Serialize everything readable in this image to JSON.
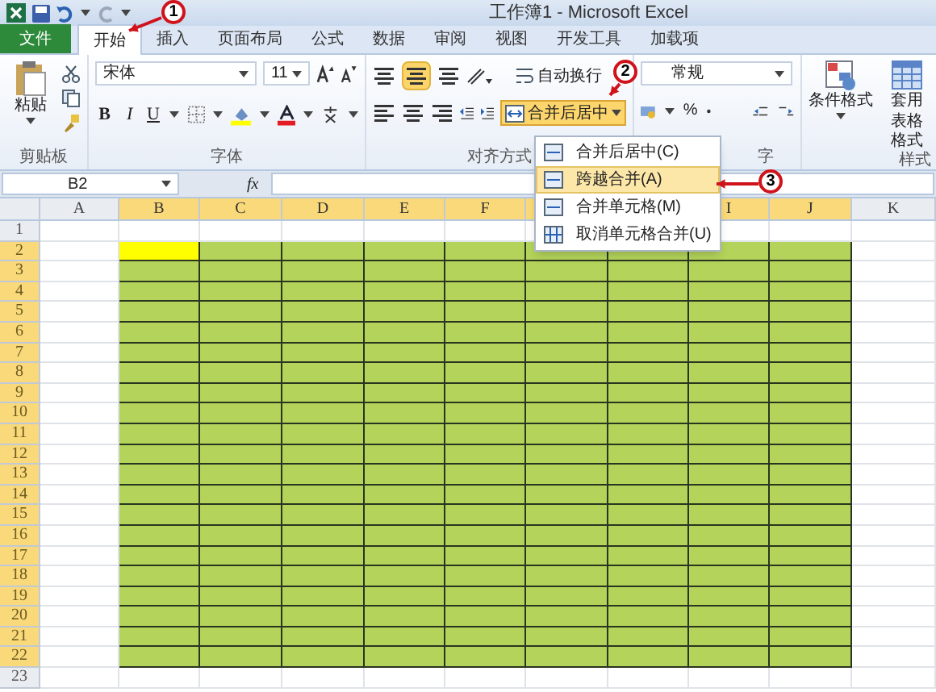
{
  "window": {
    "title": "工作簿1 - Microsoft Excel"
  },
  "tabs": [
    {
      "label": "文件",
      "kind": "file",
      "selected": false
    },
    {
      "label": "开始",
      "kind": "tab",
      "selected": true
    },
    {
      "label": "插入",
      "kind": "tab",
      "selected": false
    },
    {
      "label": "页面布局",
      "kind": "tab",
      "selected": false
    },
    {
      "label": "公式",
      "kind": "tab",
      "selected": false
    },
    {
      "label": "数据",
      "kind": "tab",
      "selected": false
    },
    {
      "label": "审阅",
      "kind": "tab",
      "selected": false
    },
    {
      "label": "视图",
      "kind": "tab",
      "selected": false
    },
    {
      "label": "开发工具",
      "kind": "tab",
      "selected": false
    },
    {
      "label": "加载项",
      "kind": "tab",
      "selected": false
    }
  ],
  "ribbon": {
    "clipboard": {
      "paste": "粘贴",
      "label": "剪贴板"
    },
    "font": {
      "name": "宋体",
      "size": "11",
      "bold": "B",
      "italic": "I",
      "underline": "U",
      "label": "字体"
    },
    "alignment": {
      "wrap": "自动换行",
      "merge": "合并后居中",
      "merge_open": true,
      "label": "对齐方式"
    },
    "number": {
      "format": "常规",
      "percent": "%",
      "label": "字"
    },
    "styles": {
      "conditional": "条件格式",
      "table": "套用表格格式",
      "label": "样式"
    }
  },
  "merge_menu": {
    "items": [
      {
        "label": "合并后居中(C)",
        "selected": false
      },
      {
        "label": "跨越合并(A)",
        "selected": true
      },
      {
        "label": "合并单元格(M)",
        "selected": false
      },
      {
        "label": "取消单元格合并(U)",
        "selected": false
      }
    ]
  },
  "formula_bar": {
    "name_box": "B2",
    "fx": "fx"
  },
  "sheet": {
    "columns": [
      {
        "label": "A",
        "selected": false
      },
      {
        "label": "B",
        "selected": true,
        "active": true
      },
      {
        "label": "C",
        "selected": true
      },
      {
        "label": "D",
        "selected": true
      },
      {
        "label": "E",
        "selected": true
      },
      {
        "label": "F",
        "selected": true
      },
      {
        "selected": true
      },
      {
        "selected": true
      },
      {
        "label": "I",
        "selected": true
      },
      {
        "label": "J",
        "selected": true
      },
      {
        "label": "K",
        "selected": false
      }
    ],
    "rows": [
      {
        "label": "1",
        "selected": false
      },
      {
        "label": "2",
        "selected": true,
        "active": true
      },
      {
        "label": "3",
        "selected": true,
        "active": false
      },
      {
        "label": "4",
        "selected": true,
        "active": false
      },
      {
        "label": "5",
        "selected": true,
        "active": false
      },
      {
        "label": "6",
        "selected": true,
        "active": false
      },
      {
        "label": "7",
        "selected": true,
        "active": false
      },
      {
        "label": "8",
        "selected": true,
        "active": false
      },
      {
        "label": "9",
        "selected": true,
        "active": false
      },
      {
        "label": "10",
        "selected": true,
        "active": false
      },
      {
        "label": "11",
        "selected": true,
        "active": false
      },
      {
        "label": "12",
        "selected": true,
        "active": false
      },
      {
        "label": "13",
        "selected": true,
        "active": false
      },
      {
        "label": "14",
        "selected": true,
        "active": false
      },
      {
        "label": "15",
        "selected": true,
        "active": false
      },
      {
        "label": "16",
        "selected": true,
        "active": false
      },
      {
        "label": "17",
        "selected": true,
        "active": false
      },
      {
        "label": "18",
        "selected": true,
        "active": false
      },
      {
        "label": "19",
        "selected": true,
        "active": false
      },
      {
        "label": "20",
        "selected": true,
        "active": false
      },
      {
        "label": "21",
        "selected": true,
        "active": false
      },
      {
        "label": "22",
        "selected": true,
        "active": false
      },
      {
        "label": "23",
        "selected": false
      }
    ]
  },
  "callouts": [
    {
      "label": "1"
    },
    {
      "label": "2"
    },
    {
      "label": "3"
    }
  ]
}
